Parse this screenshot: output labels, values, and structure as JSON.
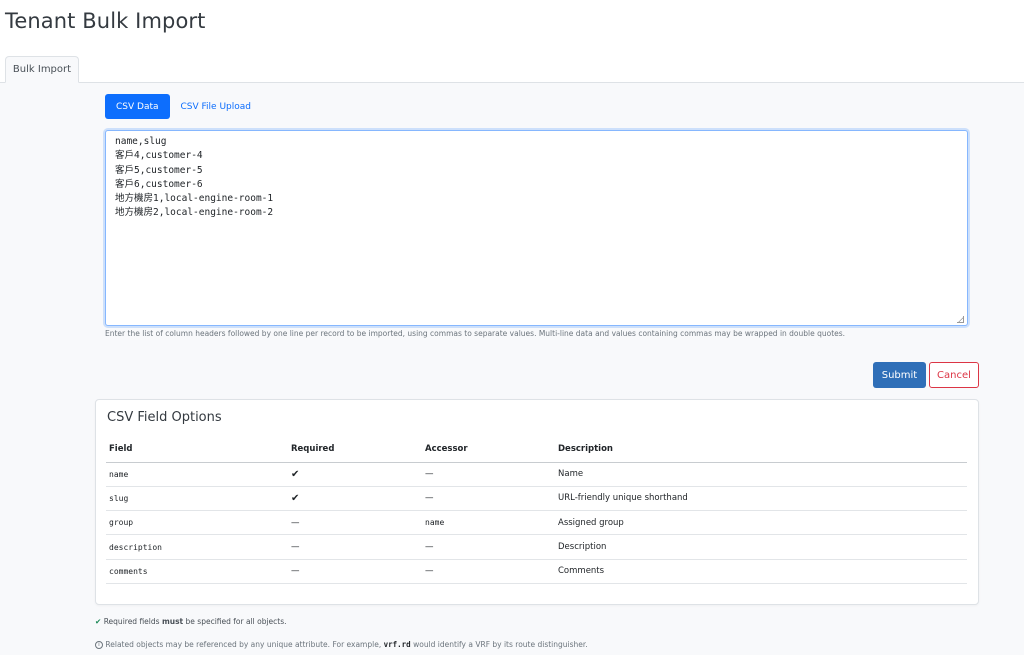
{
  "page": {
    "title": "Tenant Bulk Import"
  },
  "tabs": {
    "bulk_import": "Bulk Import"
  },
  "subtabs": {
    "csv_data": "CSV Data",
    "csv_file_upload": "CSV File Upload"
  },
  "csv_input": {
    "value": "name,slug\n客戶4,customer-4\n客戶5,customer-5\n客戶6,customer-6\n地方機房1,local-engine-room-1\n地方機房2,local-engine-room-2"
  },
  "help_text": "Enter the list of column headers followed by one line per record to be imported, using commas to separate values. Multi-line data and values containing commas may be wrapped in double quotes.",
  "actions": {
    "submit": "Submit",
    "cancel": "Cancel"
  },
  "field_options": {
    "title": "CSV Field Options",
    "headers": [
      "Field",
      "Required",
      "Accessor",
      "Description"
    ],
    "rows": [
      {
        "field": "name",
        "required": "✔",
        "accessor": "—",
        "description": "Name"
      },
      {
        "field": "slug",
        "required": "✔",
        "accessor": "—",
        "description": "URL-friendly unique shorthand"
      },
      {
        "field": "group",
        "required": "—",
        "accessor": "name",
        "description": "Assigned group"
      },
      {
        "field": "description",
        "required": "—",
        "accessor": "—",
        "description": "Description"
      },
      {
        "field": "comments",
        "required": "—",
        "accessor": "—",
        "description": "Comments"
      }
    ]
  },
  "footnotes": {
    "required_prefix": "Required fields",
    "required_emphasis": "must",
    "required_suffix": "be specified for all objects.",
    "related_prefix": "Related objects may be referenced by any unique attribute. For example,",
    "related_code": "vrf.rd",
    "related_suffix": "would identify a VRF by its route distinguisher."
  },
  "colors": {
    "primary": "#0d6efd",
    "submit": "#2f6fb8",
    "danger": "#dc3545",
    "success": "#198754"
  }
}
